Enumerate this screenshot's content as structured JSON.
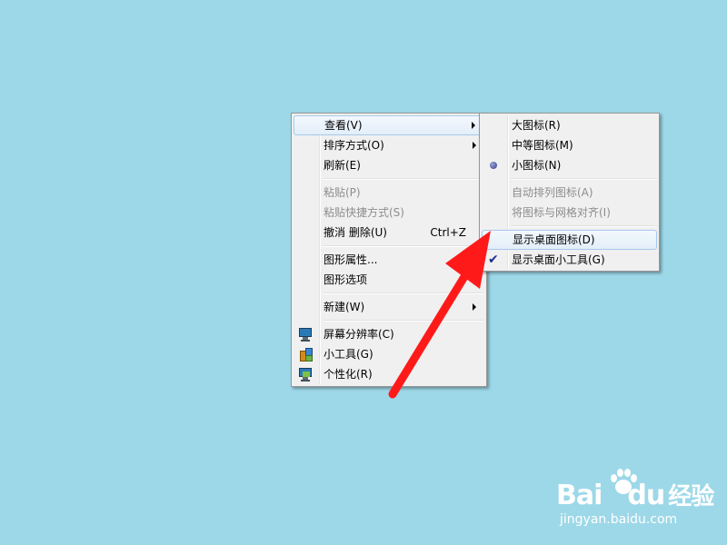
{
  "main_menu": {
    "view_label": "查看(V)",
    "sort_label": "排序方式(O)",
    "refresh_label": "刷新(E)",
    "paste_label": "粘贴(P)",
    "paste_shortcut_label": "粘贴快捷方式(S)",
    "undo_label": "撤消 删除(U)",
    "undo_shortcut": "Ctrl+Z",
    "graphics_props_label": "图形属性...",
    "graphics_options_label": "图形选项",
    "new_label": "新建(W)",
    "screen_resolution_label": "屏幕分辨率(C)",
    "gadgets_label": "小工具(G)",
    "personalize_label": "个性化(R)"
  },
  "view_submenu": {
    "large_icons_label": "大图标(R)",
    "medium_icons_label": "中等图标(M)",
    "small_icons_label": "小图标(N)",
    "auto_arrange_label": "自动排列图标(A)",
    "align_grid_label": "将图标与网格对齐(I)",
    "show_desktop_icons_label": "显示桌面图标(D)",
    "show_desktop_gadgets_label": "显示桌面小工具(G)",
    "selected_view": "small_icons",
    "show_desktop_gadgets_checked": true
  },
  "colors": {
    "desktop_background": "#9dd8e8",
    "annotation_arrow": "#ff1a1a"
  },
  "watermark": {
    "logo_text": "Bai",
    "logo_du": "du",
    "logo_suffix": "经验",
    "url": "jingyan.baidu.com"
  }
}
